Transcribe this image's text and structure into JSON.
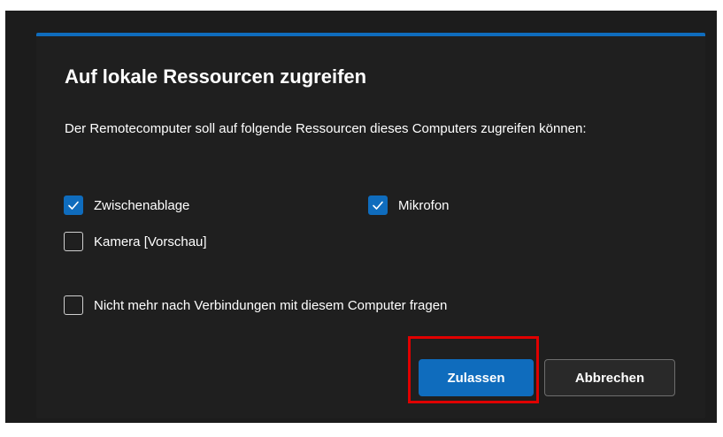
{
  "dialog": {
    "title": "Auf lokale Ressourcen zugreifen",
    "description": "Der Remotecomputer soll auf folgende Ressourcen dieses Computers zugreifen können:",
    "accent_color": "#0f6cbd",
    "background_color": "#1f1f1f"
  },
  "options": {
    "clipboard": {
      "label": "Zwischenablage",
      "checked": true
    },
    "microphone": {
      "label": "Mikrofon",
      "checked": true
    },
    "camera": {
      "label": "Kamera [Vorschau]",
      "checked": false
    },
    "dont_ask": {
      "label": "Nicht mehr nach Verbindungen mit diesem Computer fragen",
      "checked": false
    }
  },
  "buttons": {
    "allow_label": "Zulassen",
    "cancel_label": "Abbrechen"
  },
  "annotation": {
    "highlight_color": "#e00000"
  },
  "icons": {
    "check": "checkmark-icon"
  }
}
